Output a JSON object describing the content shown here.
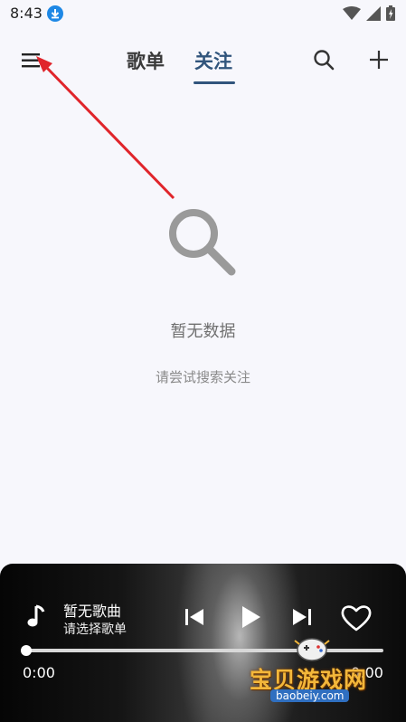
{
  "status_bar": {
    "time": "8:43",
    "icons": [
      "download-icon",
      "wifi-icon",
      "signal-icon",
      "battery-icon"
    ]
  },
  "header": {
    "tabs": [
      {
        "label": "歌单",
        "active": false
      },
      {
        "label": "关注",
        "active": true
      }
    ],
    "accent_color": "#31557c"
  },
  "empty_state": {
    "title": "暂无数据",
    "hint": "请尝试搜索关注"
  },
  "player": {
    "song_title": "暂无歌曲",
    "song_subtitle": "请选择歌单",
    "current_time": "0:00",
    "total_time": "0:00",
    "progress": 0
  },
  "watermark": {
    "text": "宝贝游戏网",
    "url": "baobeiy.com"
  }
}
